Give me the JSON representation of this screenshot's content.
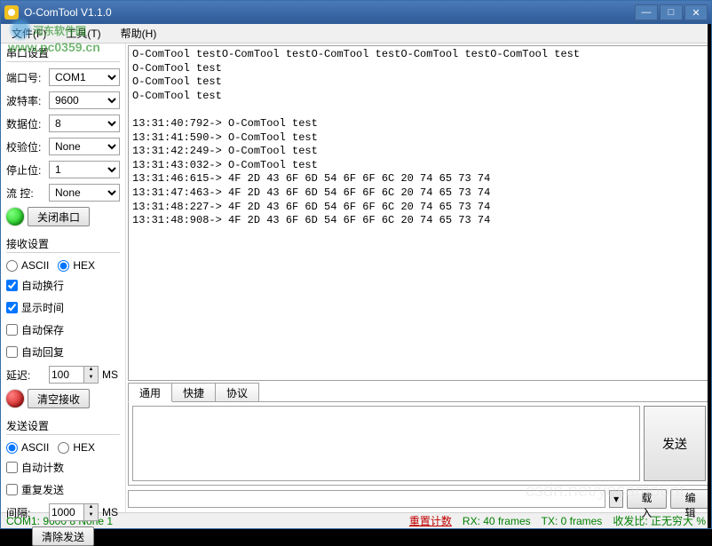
{
  "title": "O-ComTool V1.1.0",
  "watermark": {
    "main": "河东软件园",
    "url": "www.pc0359.cn",
    "right": "csdn.net/yesamount"
  },
  "menu": {
    "file": "文件(F)",
    "tool": "工具(T)",
    "help": "帮助(H)"
  },
  "port": {
    "title": "串口设置",
    "portnum": "端口号:",
    "portnum_val": "COM1",
    "baud": "波特率:",
    "baud_val": "9600",
    "databits": "数据位:",
    "databits_val": "8",
    "parity": "校验位:",
    "parity_val": "None",
    "stopbits": "停止位:",
    "stopbits_val": "1",
    "flow": "流  控:",
    "flow_val": "None",
    "close_btn": "关闭串口"
  },
  "rx_settings": {
    "title": "接收设置",
    "ascii": "ASCII",
    "hex": "HEX",
    "autowrap": "自动换行",
    "showtime": "显示时间",
    "autosave": "自动保存",
    "autoreply": "自动回复",
    "delay": "延迟:",
    "delay_val": "100",
    "ms": "MS",
    "clear_btn": "清空接收"
  },
  "tx_settings": {
    "title": "发送设置",
    "ascii": "ASCII",
    "hex": "HEX",
    "autocount": "自动计数",
    "resend": "重复发送",
    "interval": "间隔:",
    "interval_val": "1000",
    "ms": "MS",
    "clear_btn": "清除发送"
  },
  "tabs": {
    "general": "通用",
    "quick": "快捷",
    "protocol": "协议"
  },
  "buttons": {
    "send": "发送",
    "load": "载入",
    "edit": "编辑"
  },
  "rx_text": "O-ComTool testO-ComTool testO-ComTool testO-ComTool testO-ComTool test\nO-ComTool test\nO-ComTool test\nO-ComTool test\n\n13:31:40:792-> O-ComTool test\n13:31:41:590-> O-ComTool test\n13:31:42:249-> O-ComTool test\n13:31:43:032-> O-ComTool test\n13:31:46:615-> 4F 2D 43 6F 6D 54 6F 6F 6C 20 74 65 73 74 \n13:31:47:463-> 4F 2D 43 6F 6D 54 6F 6F 6C 20 74 65 73 74 \n13:31:48:227-> 4F 2D 43 6F 6D 54 6F 6F 6C 20 74 65 73 74 \n13:31:48:908-> 4F 2D 43 6F 6D 54 6F 6F 6C 20 74 65 73 74 ",
  "status": {
    "port": "COM1: 9600  8  None  1",
    "reset": "重置计数",
    "rx": "RX: 40 frames",
    "tx": "TX: 0 frames",
    "rate": "收发比: 正无穷大 %"
  }
}
